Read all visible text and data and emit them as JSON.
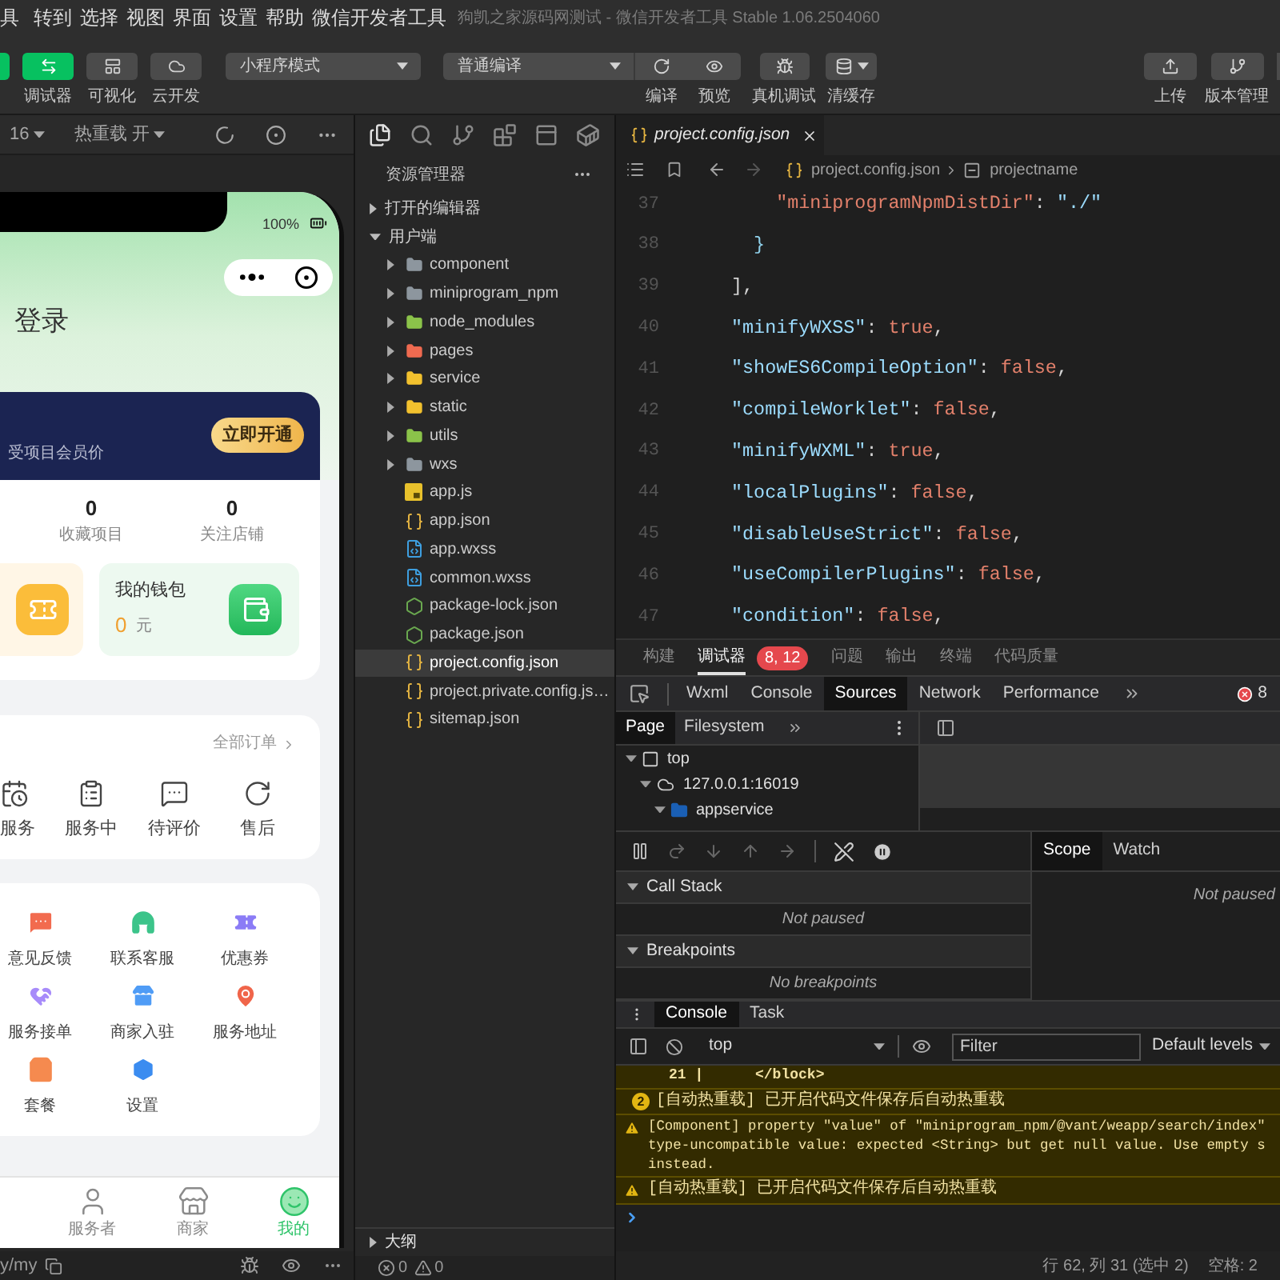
{
  "menu_bar": {
    "items": [
      "具",
      "转到",
      "选择",
      "视图",
      "界面",
      "设置",
      "帮助",
      "微信开发者工具"
    ],
    "title": "狗凯之家源码网测试 - 微信开发者工具 Stable 1.06.2504060"
  },
  "toolbar": {
    "toggles": [
      {
        "on": true
      },
      {
        "label": "调试器",
        "on": true
      },
      {
        "label": "可视化",
        "on": false
      },
      {
        "label": "云开发",
        "on": false
      }
    ],
    "mode": "小程序模式",
    "compile_mode": "普通编译",
    "actions": [
      "编译",
      "预览",
      "真机调试",
      "清缓存"
    ],
    "right_actions": [
      "上传",
      "版本管理"
    ]
  },
  "simulator": {
    "device": "16",
    "hot_reload": "热重载 开",
    "battery": "100%",
    "login_prompt": "登录",
    "vip": {
      "text": "受项目会员价",
      "button": "立即开通"
    },
    "stats": [
      {
        "value": "0",
        "label": "收藏项目"
      },
      {
        "value": "0",
        "label": "关注店铺"
      }
    ],
    "wallet": {
      "title": "我的钱包",
      "amount": "0",
      "unit": "元"
    },
    "orders": {
      "link": "全部订单",
      "items": [
        "服务",
        "服务中",
        "待评价",
        "售后"
      ]
    },
    "services": [
      "意见反馈",
      "联系客服",
      "优惠券",
      "服务接单",
      "商家入驻",
      "服务地址",
      "套餐",
      "设置"
    ],
    "tab_bar": [
      {
        "label": "服务者",
        "selected": false
      },
      {
        "label": "商家",
        "selected": false
      },
      {
        "label": "我的",
        "selected": true
      }
    ],
    "path": "y/my"
  },
  "explorer": {
    "title": "资源管理器",
    "sections": [
      {
        "label": "打开的编辑器",
        "expanded": false
      },
      {
        "label": "用户端",
        "expanded": true,
        "children": [
          {
            "name": "component",
            "kind": "folder",
            "color": "#8d969e",
            "expanded": false,
            "selected": false
          },
          {
            "name": "miniprogram_npm",
            "kind": "folder",
            "color": "#8d969e",
            "expanded": false,
            "selected": false
          },
          {
            "name": "node_modules",
            "kind": "folder",
            "color": "#8bc34a",
            "expanded": false,
            "selected": false
          },
          {
            "name": "pages",
            "kind": "folder",
            "color": "#ef6a50",
            "expanded": false,
            "selected": false
          },
          {
            "name": "service",
            "kind": "folder",
            "color": "#f2c12e",
            "expanded": false,
            "selected": false
          },
          {
            "name": "static",
            "kind": "folder",
            "color": "#f2c12e",
            "expanded": false,
            "selected": false
          },
          {
            "name": "utils",
            "kind": "folder",
            "color": "#8bc34a",
            "expanded": false,
            "selected": false
          },
          {
            "name": "wxs",
            "kind": "folder",
            "color": "#8d969e",
            "expanded": false,
            "selected": false
          },
          {
            "name": "app.js",
            "kind": "js",
            "selected": false
          },
          {
            "name": "app.json",
            "kind": "json",
            "selected": false
          },
          {
            "name": "app.wxss",
            "kind": "style",
            "selected": false
          },
          {
            "name": "common.wxss",
            "kind": "style",
            "selected": false
          },
          {
            "name": "package-lock.json",
            "kind": "package",
            "selected": false
          },
          {
            "name": "package.json",
            "kind": "package",
            "selected": false
          },
          {
            "name": "project.config.json",
            "kind": "json",
            "selected": true
          },
          {
            "name": "project.private.config.js…",
            "kind": "json",
            "selected": false
          },
          {
            "name": "sitemap.json",
            "kind": "json",
            "selected": false
          }
        ]
      }
    ],
    "outline": {
      "label": "大纲",
      "expanded": false
    },
    "errors": "0",
    "warnings": "0"
  },
  "editor": {
    "tab": {
      "label": "project.config.json",
      "selected": true
    },
    "breadcrumb": [
      "project.config.json",
      "projectname"
    ],
    "lines": [
      {
        "number": "37",
        "tokens": [
          {
            "text": "      \"miniprogramNpmDistDir\"",
            "kind": "nested"
          },
          {
            "text": ": ",
            "kind": "punct"
          },
          {
            "text": "\"./\"",
            "kind": "string"
          }
        ]
      },
      {
        "number": "38",
        "tokens": [
          {
            "text": "    }",
            "kind": "brace"
          }
        ]
      },
      {
        "number": "39",
        "tokens": [
          {
            "text": "  ],",
            "kind": "punct"
          }
        ]
      },
      {
        "number": "40",
        "tokens": [
          {
            "text": "  \"minifyWXSS\"",
            "kind": "key"
          },
          {
            "text": ": ",
            "kind": "punct"
          },
          {
            "text": "true",
            "kind": "literal"
          },
          {
            "text": ",",
            "kind": "punct"
          }
        ]
      },
      {
        "number": "41",
        "tokens": [
          {
            "text": "  \"showES6CompileOption\"",
            "kind": "key"
          },
          {
            "text": ": ",
            "kind": "punct"
          },
          {
            "text": "false",
            "kind": "literal"
          },
          {
            "text": ",",
            "kind": "punct"
          }
        ]
      },
      {
        "number": "42",
        "tokens": [
          {
            "text": "  \"compileWorklet\"",
            "kind": "key"
          },
          {
            "text": ": ",
            "kind": "punct"
          },
          {
            "text": "false",
            "kind": "literal"
          },
          {
            "text": ",",
            "kind": "punct"
          }
        ]
      },
      {
        "number": "43",
        "tokens": [
          {
            "text": "  \"minifyWXML\"",
            "kind": "key"
          },
          {
            "text": ": ",
            "kind": "punct"
          },
          {
            "text": "true",
            "kind": "literal"
          },
          {
            "text": ",",
            "kind": "punct"
          }
        ]
      },
      {
        "number": "44",
        "tokens": [
          {
            "text": "  \"localPlugins\"",
            "kind": "key"
          },
          {
            "text": ": ",
            "kind": "punct"
          },
          {
            "text": "false",
            "kind": "literal"
          },
          {
            "text": ",",
            "kind": "punct"
          }
        ]
      },
      {
        "number": "45",
        "tokens": [
          {
            "text": "  \"disableUseStrict\"",
            "kind": "key"
          },
          {
            "text": ": ",
            "kind": "punct"
          },
          {
            "text": "false",
            "kind": "literal"
          },
          {
            "text": ",",
            "kind": "punct"
          }
        ]
      },
      {
        "number": "46",
        "tokens": [
          {
            "text": "  \"useCompilerPlugins\"",
            "kind": "key"
          },
          {
            "text": ": ",
            "kind": "punct"
          },
          {
            "text": "false",
            "kind": "literal"
          },
          {
            "text": ",",
            "kind": "punct"
          }
        ]
      },
      {
        "number": "47",
        "tokens": [
          {
            "text": "  \"condition\"",
            "kind": "key"
          },
          {
            "text": ": ",
            "kind": "punct"
          },
          {
            "text": "false",
            "kind": "literal"
          },
          {
            "text": ",",
            "kind": "punct"
          }
        ]
      }
    ]
  },
  "panel": {
    "tabs": [
      {
        "label": "构建",
        "selected": false
      },
      {
        "label": "调试器",
        "selected": true,
        "badge": "8, 12"
      },
      {
        "label": "问题",
        "selected": false
      },
      {
        "label": "输出",
        "selected": false
      },
      {
        "label": "终端",
        "selected": false
      },
      {
        "label": "代码质量",
        "selected": false
      }
    ],
    "devtools": {
      "tabs": [
        {
          "label": "Wxml",
          "selected": false
        },
        {
          "label": "Console",
          "selected": false
        },
        {
          "label": "Sources",
          "selected": true
        },
        {
          "label": "Network",
          "selected": false
        },
        {
          "label": "Performance",
          "selected": false
        }
      ],
      "error_count": "8",
      "sources": {
        "tabs": [
          {
            "label": "Page",
            "selected": true
          },
          {
            "label": "Filesystem",
            "selected": false
          }
        ],
        "tree": [
          {
            "label": "top",
            "kind": "frame",
            "expanded": true,
            "children": [
              {
                "label": "127.0.0.1:16019",
                "kind": "origin",
                "expanded": true,
                "children": [
                  {
                    "label": "appservice",
                    "kind": "folder",
                    "expanded": true
                  }
                ]
              }
            ]
          }
        ]
      },
      "debugger": {
        "sections": [
          {
            "title": "Call Stack",
            "expanded": true,
            "message": "Not paused"
          },
          {
            "title": "Breakpoints",
            "expanded": true,
            "message": "No breakpoints"
          }
        ],
        "side_tabs": [
          {
            "label": "Scope",
            "selected": true
          },
          {
            "label": "Watch",
            "selected": false
          }
        ],
        "side_message": "Not paused"
      }
    },
    "drawer_tabs": [
      {
        "label": "Console",
        "selected": true
      },
      {
        "label": "Task",
        "selected": false
      }
    ],
    "console": {
      "context": "top",
      "filter": {
        "placeholder": "Filter"
      },
      "levels": "Default levels",
      "messages": [
        {
          "kind": "code",
          "lines": [
            "21 |      </block>"
          ]
        },
        {
          "kind": "repeated",
          "count": "2",
          "lines": [
            "[自动热重载] 已开启代码文件保存后自动热重载"
          ]
        },
        {
          "kind": "warning",
          "lines": [
            "[Component] property \"value\" of \"miniprogram_npm/@vant/weapp/search/index\"",
            "type-uncompatible value: expected <String> but get null value. Use empty s",
            "instead."
          ]
        },
        {
          "kind": "warning",
          "lines": [
            "[自动热重载] 已开启代码文件保存后自动热重载"
          ]
        }
      ]
    }
  },
  "status_bar": {
    "position": "行 62, 列 31 (选中 2)",
    "indentation": "空格: 2"
  }
}
